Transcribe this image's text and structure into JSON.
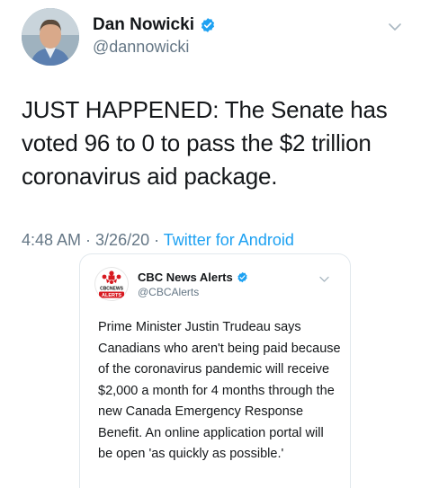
{
  "tweet": {
    "author_name": "Dan Nowicki",
    "author_handle": "@dannowicki",
    "text": "JUST HAPPENED: The Senate has voted 96 to 0 to pass the $2 trillion coronavirus aid package.",
    "time": "4:48 AM",
    "date": "3/26/20",
    "source": "Twitter for Android",
    "separator": " · "
  },
  "quoted": {
    "author_name": "CBC News Alerts",
    "author_handle": "@CBCAlerts",
    "logo_text_top": "CBCNEWS",
    "logo_text_bottom": "ALERTS",
    "text": "Prime Minister Justin Trudeau says Canadians who aren't being paid because of the coronavirus pandemic will receive $2,000 a month for 4 months through the new Canada Emergency Response Benefit. An online application portal will be open 'as quickly as possible.'"
  },
  "icons": {
    "verified": "verified-badge-icon",
    "more": "chevron-down-icon",
    "cbc_logo": "cbc-gem-logo"
  },
  "colors": {
    "link": "#1da1f2",
    "muted": "#657786",
    "cbc_red": "#d71920",
    "verified": "#1da1f2"
  }
}
